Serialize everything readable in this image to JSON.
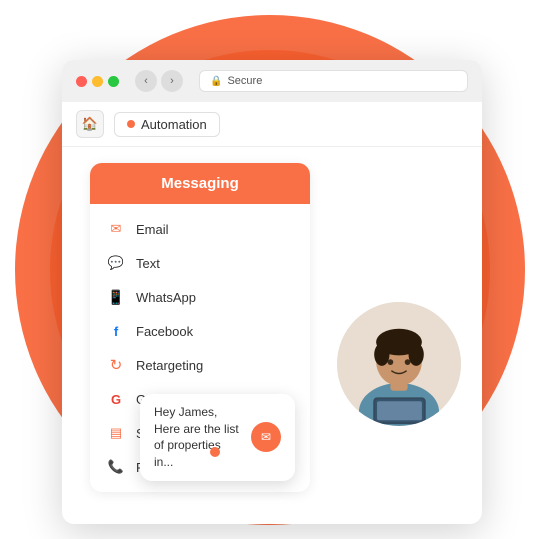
{
  "browser": {
    "address": "Secure",
    "back_label": "‹",
    "forward_label": "›",
    "breadcrumb": "Automation",
    "home_icon": "🏠"
  },
  "messaging_card": {
    "header": "Messaging",
    "items": [
      {
        "id": "email",
        "label": "Email",
        "icon": "✉",
        "icon_class": "icon-email"
      },
      {
        "id": "text",
        "label": "Text",
        "icon": "💬",
        "icon_class": "icon-text"
      },
      {
        "id": "whatsapp",
        "label": "WhatsApp",
        "icon": "📱",
        "icon_class": "icon-whatsapp"
      },
      {
        "id": "facebook",
        "label": "Facebook",
        "icon": "f",
        "icon_class": "icon-facebook"
      },
      {
        "id": "retargeting",
        "label": "Retargeting",
        "icon": "↺",
        "icon_class": "icon-retargeting"
      },
      {
        "id": "google",
        "label": "Google Remarketing",
        "icon": "G",
        "icon_class": "icon-google"
      },
      {
        "id": "portal",
        "label": "Self-serve Portal",
        "icon": "▤",
        "icon_class": "icon-portal"
      },
      {
        "id": "phone",
        "label": "Phone Call",
        "icon": "📞",
        "icon_class": "icon-phone"
      }
    ]
  },
  "chat_bubble": {
    "text": "Hey James,\nHere are the list\nof properties in...",
    "email_icon": "✉"
  },
  "colors": {
    "orange": "#f97046",
    "orange_dark": "#f74e18",
    "orange_mid": "#f96030"
  }
}
